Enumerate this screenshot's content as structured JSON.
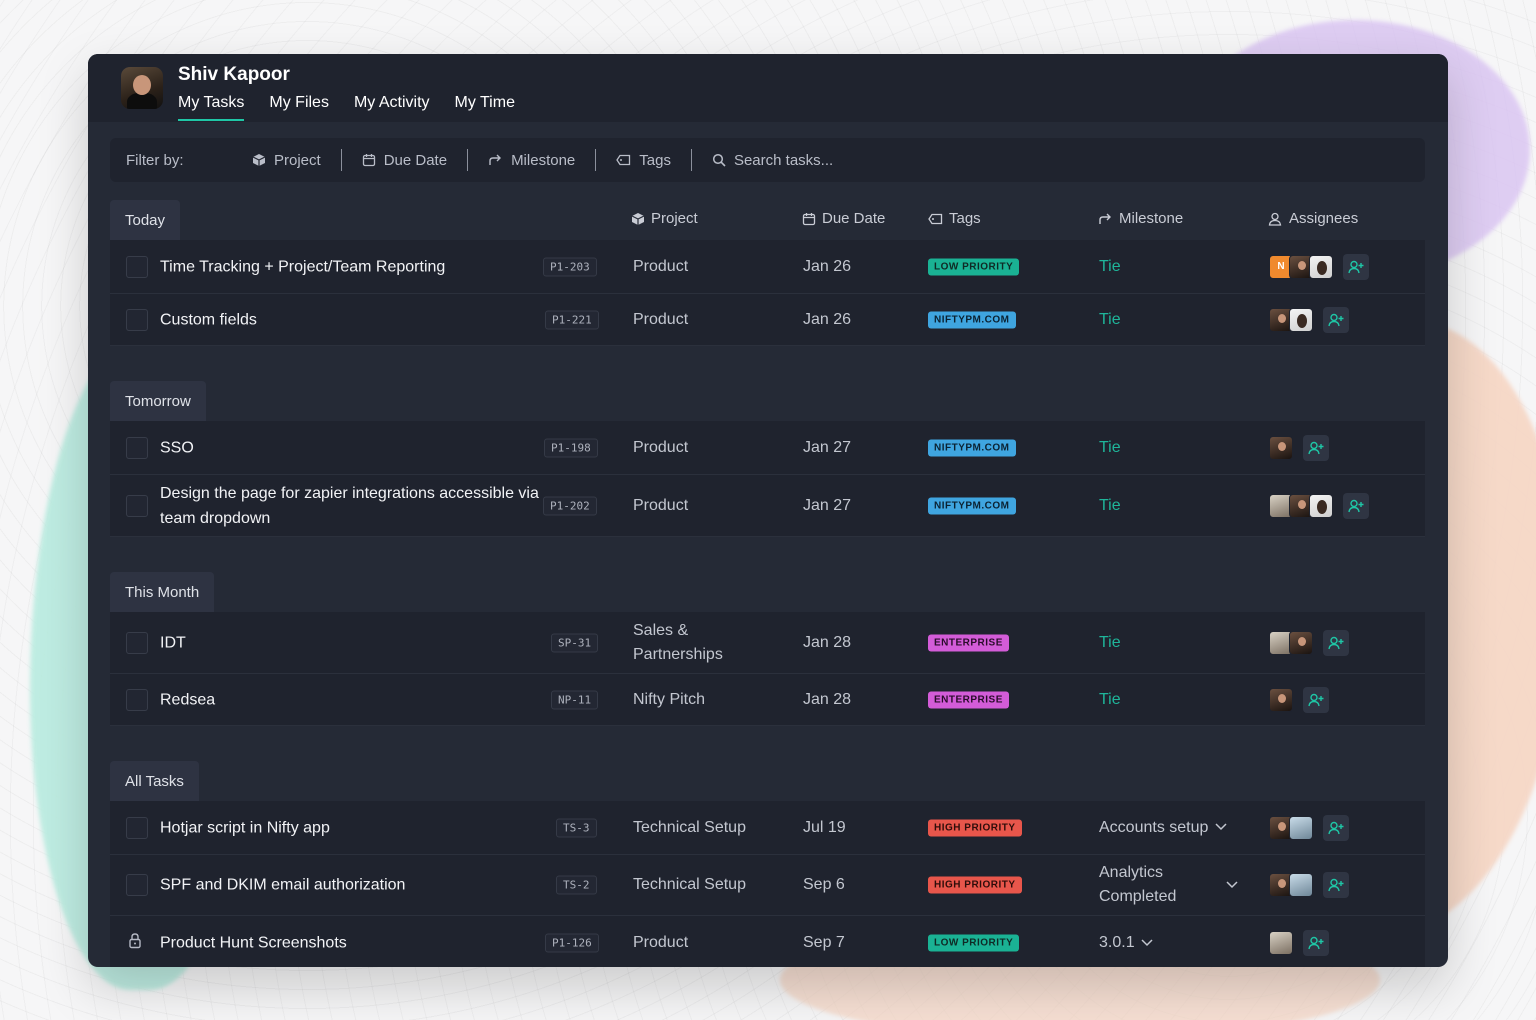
{
  "user": {
    "name": "Shiv Kapoor"
  },
  "tabs": [
    "My Tasks",
    "My Files",
    "My Activity",
    "My Time"
  ],
  "filter": {
    "label": "Filter by:",
    "items": [
      "Project",
      "Due Date",
      "Milestone",
      "Tags"
    ],
    "search_placeholder": "Search tasks..."
  },
  "columns": {
    "project": "Project",
    "due_date": "Due Date",
    "tags": "Tags",
    "milestone": "Milestone",
    "assignees": "Assignees"
  },
  "sections": [
    {
      "title": "Today",
      "tasks": [
        {
          "title": "Time Tracking + Project/Team Reporting",
          "id": "P1-203",
          "project": "Product",
          "due": "Jan 26",
          "tag": "LOW PRIORITY",
          "milestone": "Tie",
          "assignees": [
            "N",
            "person",
            "person"
          ]
        },
        {
          "title": "Custom fields",
          "id": "P1-221",
          "project": "Product",
          "due": "Jan 26",
          "tag": "NIFTYPM.COM",
          "milestone": "Tie",
          "assignees": [
            "person",
            "person"
          ]
        }
      ]
    },
    {
      "title": "Tomorrow",
      "tasks": [
        {
          "title": "SSO",
          "id": "P1-198",
          "project": "Product",
          "due": "Jan 27",
          "tag": "NIFTYPM.COM",
          "milestone": "Tie",
          "assignees": [
            "person"
          ]
        },
        {
          "title": "Design the page for zapier integrations accessible via team dropdown",
          "id": "P1-202",
          "project": "Product",
          "due": "Jan 27",
          "tag": "NIFTYPM.COM",
          "milestone": "Tie",
          "assignees": [
            "person",
            "person",
            "person"
          ]
        }
      ]
    },
    {
      "title": "This Month",
      "tasks": [
        {
          "title": "IDT",
          "id": "SP-31",
          "project": "Sales & Partnerships",
          "due": "Jan 28",
          "tag": "ENTERPRISE",
          "milestone": "Tie",
          "assignees": [
            "person",
            "person"
          ]
        },
        {
          "title": "Redsea",
          "id": "NP-11",
          "project": "Nifty Pitch",
          "due": "Jan 28",
          "tag": "ENTERPRISE",
          "milestone": "Tie",
          "assignees": [
            "person"
          ]
        }
      ]
    },
    {
      "title": "All Tasks",
      "tasks": [
        {
          "title": "Hotjar script in Nifty app",
          "id": "TS-3",
          "project": "Technical Setup",
          "due": "Jul 19",
          "tag": "HIGH PRIORITY",
          "milestone": "Accounts setup",
          "assignees": [
            "person",
            "person"
          ]
        },
        {
          "title": "SPF and DKIM email authorization",
          "id": "TS-2",
          "project": "Technical Setup",
          "due": "Sep 6",
          "tag": "HIGH PRIORITY",
          "milestone": "Analytics Completed",
          "assignees": [
            "person",
            "person"
          ]
        },
        {
          "title": "Product Hunt Screenshots",
          "id": "P1-126",
          "project": "Product",
          "due": "Sep 7",
          "tag": "LOW PRIORITY",
          "milestone": "3.0.1",
          "assignees": [
            "person"
          ]
        }
      ]
    }
  ],
  "colors": {
    "accent": "#1fc6a6",
    "low_priority": "#1ab294",
    "niftypm": "#3fa5e0",
    "enterprise": "#d35cd8",
    "high_priority": "#e8564b"
  }
}
